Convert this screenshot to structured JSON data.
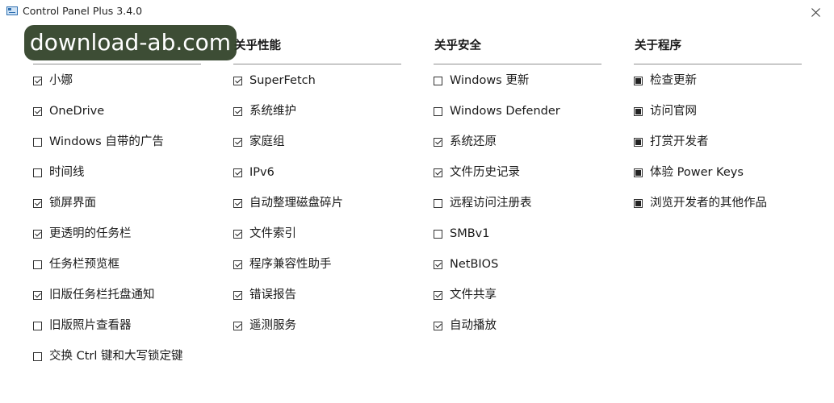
{
  "window": {
    "title": "Control Panel Plus 3.4.0"
  },
  "watermark": "download-ab.com",
  "sections": [
    {
      "title": "",
      "items": [
        {
          "label": "小娜",
          "state": "checked"
        },
        {
          "label": "OneDrive",
          "state": "checked"
        },
        {
          "label": "Windows 自带的广告",
          "state": "unchecked"
        },
        {
          "label": "时间线",
          "state": "unchecked"
        },
        {
          "label": "锁屏界面",
          "state": "checked"
        },
        {
          "label": "更透明的任务栏",
          "state": "checked"
        },
        {
          "label": "任务栏预览框",
          "state": "unchecked"
        },
        {
          "label": "旧版任务栏托盘通知",
          "state": "checked"
        },
        {
          "label": "旧版照片查看器",
          "state": "unchecked"
        },
        {
          "label": "交换 Ctrl 键和大写锁定键",
          "state": "unchecked"
        }
      ]
    },
    {
      "title": "关乎性能",
      "items": [
        {
          "label": "SuperFetch",
          "state": "checked"
        },
        {
          "label": "系统维护",
          "state": "checked"
        },
        {
          "label": "家庭组",
          "state": "checked"
        },
        {
          "label": "IPv6",
          "state": "checked"
        },
        {
          "label": "自动整理磁盘碎片",
          "state": "checked"
        },
        {
          "label": "文件索引",
          "state": "checked"
        },
        {
          "label": "程序兼容性助手",
          "state": "checked"
        },
        {
          "label": "错误报告",
          "state": "checked"
        },
        {
          "label": "遥测服务",
          "state": "checked"
        }
      ]
    },
    {
      "title": "关乎安全",
      "items": [
        {
          "label": "Windows 更新",
          "state": "unchecked"
        },
        {
          "label": "Windows Defender",
          "state": "unchecked"
        },
        {
          "label": "系统还原",
          "state": "checked"
        },
        {
          "label": "文件历史记录",
          "state": "checked"
        },
        {
          "label": "远程访问注册表",
          "state": "unchecked"
        },
        {
          "label": "SMBv1",
          "state": "unchecked"
        },
        {
          "label": "NetBIOS",
          "state": "checked"
        },
        {
          "label": "文件共享",
          "state": "checked"
        },
        {
          "label": "自动播放",
          "state": "checked"
        }
      ]
    },
    {
      "title": "关于程序",
      "items": [
        {
          "label": "检查更新",
          "state": "square"
        },
        {
          "label": "访问官网",
          "state": "square"
        },
        {
          "label": "打赏开发者",
          "state": "square"
        },
        {
          "label": "体验 Power Keys",
          "state": "square"
        },
        {
          "label": "浏览开发者的其他作品",
          "state": "square"
        }
      ]
    }
  ]
}
